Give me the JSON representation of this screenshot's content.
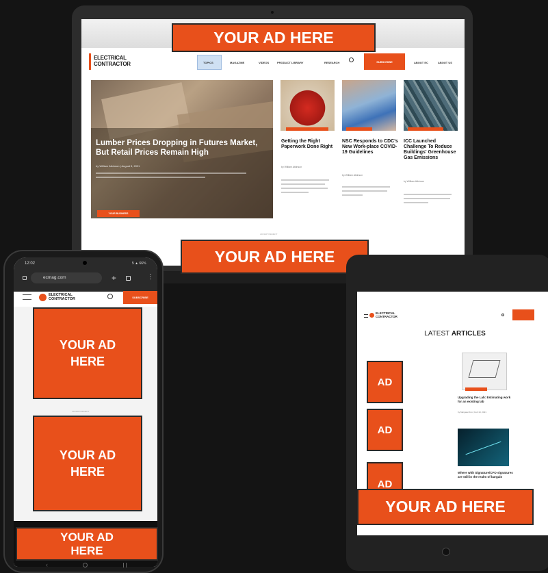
{
  "ads": {
    "laptop_top": "YOUR AD HERE",
    "laptop_bottom": "YOUR AD HERE",
    "phone_1": "YOUR AD HERE",
    "phone_2": "YOUR AD HERE",
    "phone_3": "YOUR AD HERE",
    "tablet_1": "AD",
    "tablet_2": "AD",
    "tablet_3": "AD",
    "tablet_banner": "YOUR AD HERE"
  },
  "laptop": {
    "logo_line1": "ELECTRICAL",
    "logo_line2": "CONTRACTOR",
    "nav": [
      "TOPICS",
      "MAGAZINE",
      "VIDEOS",
      "PRODUCT LIBRARY",
      "RESEARCH"
    ],
    "subscribe": "SUBSCRIBE",
    "account_links": [
      "ABOUT EC",
      "ABOUT US"
    ],
    "hero_title": "Lumber Prices Dropping in Futures Market, But Retail Prices Remain High",
    "hero_byline": "by William Atkinson | August 5, 2021",
    "hero_button": "YOUR BUSINESS",
    "cards": [
      {
        "title": "Getting the Right Paperwork Done Right",
        "meta": "by William Atkinson"
      },
      {
        "title": "NSC Responds to CDC's New Work-place COVID-19 Guidelines",
        "meta": "by William Atkinson"
      },
      {
        "title": "ICC Launched Challenge To Reduce Buildings' Greenhouse Gas Emissions",
        "meta": "by William Atkinson"
      }
    ],
    "footer_label": "ADVERTISEMENT"
  },
  "phone": {
    "status_time": "12:02",
    "status_battery": "5 ▲ 66%",
    "url": "ecmag.com",
    "logo_line1": "ELECTRICAL",
    "logo_line2": "CONTRACTOR",
    "subscribe": "SUBSCRIBE",
    "ad_label": "ADVERTISEMENT"
  },
  "tablet": {
    "logo_line1": "ELECTRICAL",
    "logo_line2": "CONTRACTOR",
    "heading_pre": "LATEST ",
    "heading_bold": "ARTICLES",
    "articles": [
      {
        "title": "Upgrading the Lab: Estimating work for an existing lab",
        "meta": "by Margaret Fox | Feb 10, 2021"
      },
      {
        "title": "Where with Signature/CFO signatures are still in the realm of bargain",
        "meta": ""
      }
    ]
  }
}
